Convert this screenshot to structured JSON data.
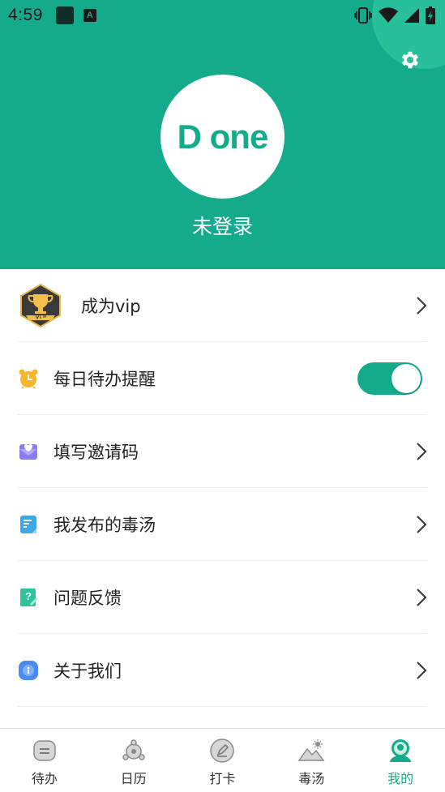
{
  "status_bar": {
    "time": "4:59",
    "a_glyph": "A"
  },
  "header": {
    "background_color": "#14aa8c",
    "logo_text": "D one",
    "login_status": "未登录",
    "settings_icon": "gear-icon"
  },
  "menu": {
    "vip": {
      "label": "成为vip",
      "icon": "trophy-vip-icon"
    },
    "reminder": {
      "label": "每日待办提醒",
      "icon": "alarm-clock-icon",
      "enabled": true
    },
    "invite": {
      "label": "填写邀请码",
      "icon": "heart-envelope-icon"
    },
    "posts": {
      "label": "我发布的毒汤",
      "icon": "document-icon"
    },
    "feedback": {
      "label": "问题反馈",
      "icon": "question-note-icon"
    },
    "about": {
      "label": "关于我们",
      "icon": "info-icon"
    }
  },
  "tabbar": {
    "active_color": "#14aa8c",
    "tabs": [
      {
        "label": "待办",
        "icon": "todo-icon"
      },
      {
        "label": "日历",
        "icon": "calendar-icon"
      },
      {
        "label": "打卡",
        "icon": "checkin-icon"
      },
      {
        "label": "毒汤",
        "icon": "mountain-icon"
      },
      {
        "label": "我的",
        "icon": "profile-icon",
        "active": true
      }
    ]
  }
}
